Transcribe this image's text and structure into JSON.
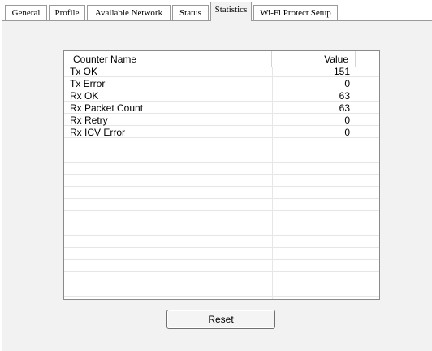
{
  "tabs": [
    {
      "label": "General",
      "active": false
    },
    {
      "label": "Profile",
      "active": false
    },
    {
      "label": "Available Network",
      "active": false
    },
    {
      "label": "Status",
      "active": false
    },
    {
      "label": "Statistics",
      "active": true
    },
    {
      "label": "Wi-Fi Protect Setup",
      "active": false
    }
  ],
  "counters": {
    "columns": {
      "name": "Counter Name",
      "value": "Value"
    },
    "rows": [
      {
        "name": "Tx OK",
        "value": "151"
      },
      {
        "name": "Tx Error",
        "value": "0"
      },
      {
        "name": "Rx OK",
        "value": "63"
      },
      {
        "name": "Rx Packet Count",
        "value": "63"
      },
      {
        "name": "Rx Retry",
        "value": "0"
      },
      {
        "name": "Rx ICV Error",
        "value": "0"
      }
    ]
  },
  "reset_label": "Reset"
}
